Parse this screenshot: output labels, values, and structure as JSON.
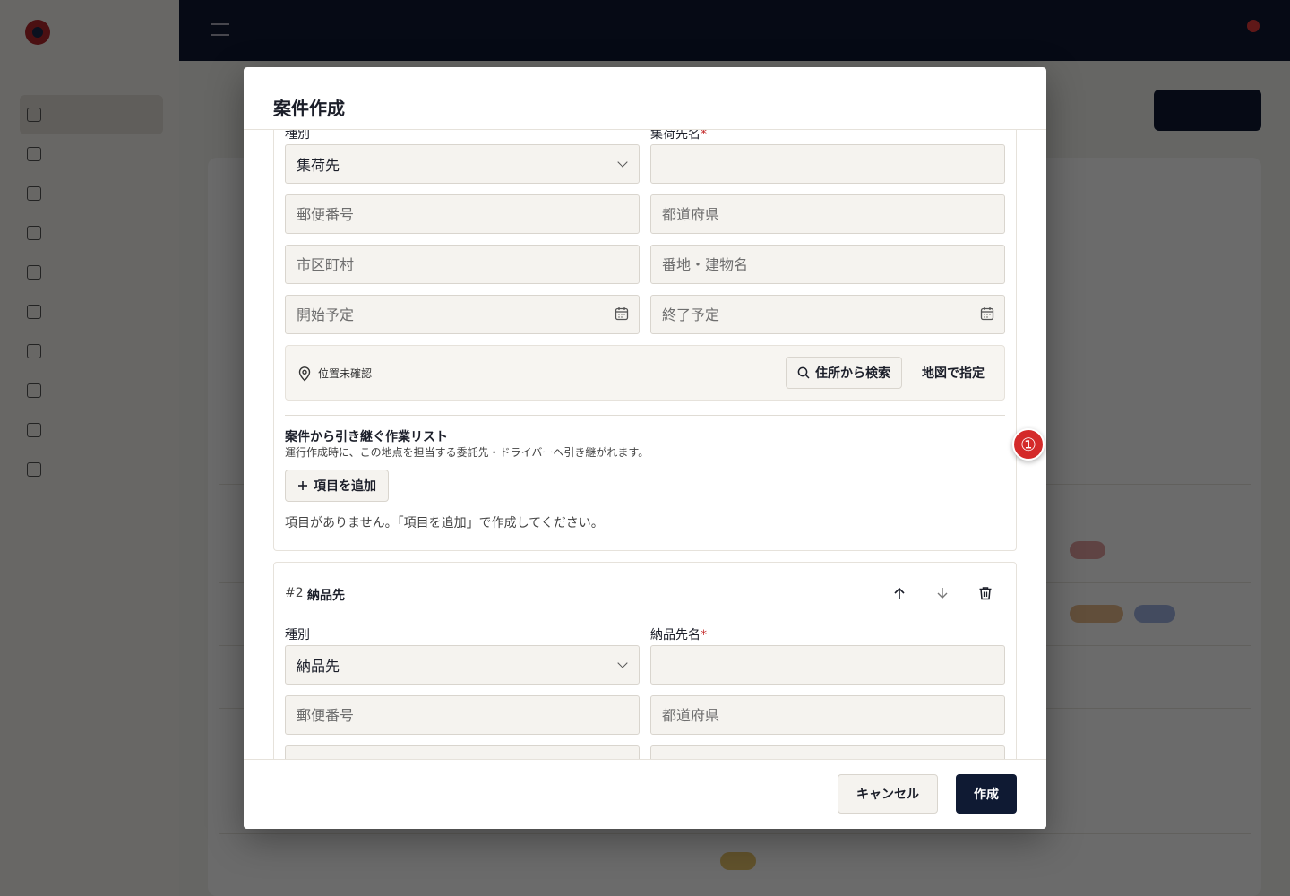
{
  "modal": {
    "title": "案件作成",
    "stop1": {
      "type_label": "種別",
      "type_value": "集荷先",
      "name_label": "集荷先名",
      "required_mark": "*",
      "postal_placeholder": "郵便番号",
      "prefecture_placeholder": "都道府県",
      "city_placeholder": "市区町村",
      "address_placeholder": "番地・建物名",
      "start_placeholder": "開始予定",
      "end_placeholder": "終了予定",
      "location_status": "位置未確認",
      "search_address_label": "住所から検索",
      "map_label": "地図で指定",
      "task_list_title": "案件から引き継ぐ作業リスト",
      "task_list_desc": "運行作成時に、この地点を担当する委託先・ドライバーへ引き継がれます。",
      "add_item_label": "項目を追加",
      "empty_message": "項目がありません。「項目を追加」で作成してください。"
    },
    "stop2": {
      "index": "#2",
      "title": "納品先",
      "type_label": "種別",
      "type_value": "納品先",
      "name_label": "納品先名",
      "required_mark": "*",
      "postal_placeholder": "郵便番号",
      "prefecture_placeholder": "都道府県"
    },
    "footer": {
      "cancel_label": "キャンセル",
      "create_label": "作成"
    }
  },
  "step_marker": "①",
  "icons": [
    "chevron-down-icon",
    "calendar-icon",
    "map-pin-icon",
    "search-icon",
    "plus-icon",
    "arrow-up-icon",
    "arrow-down-icon",
    "trash-icon"
  ],
  "colors": {
    "primary": "#0f1a33",
    "required": "#c42b2b",
    "marker": "#d42a2a",
    "field_bg": "#f5f3ef"
  }
}
